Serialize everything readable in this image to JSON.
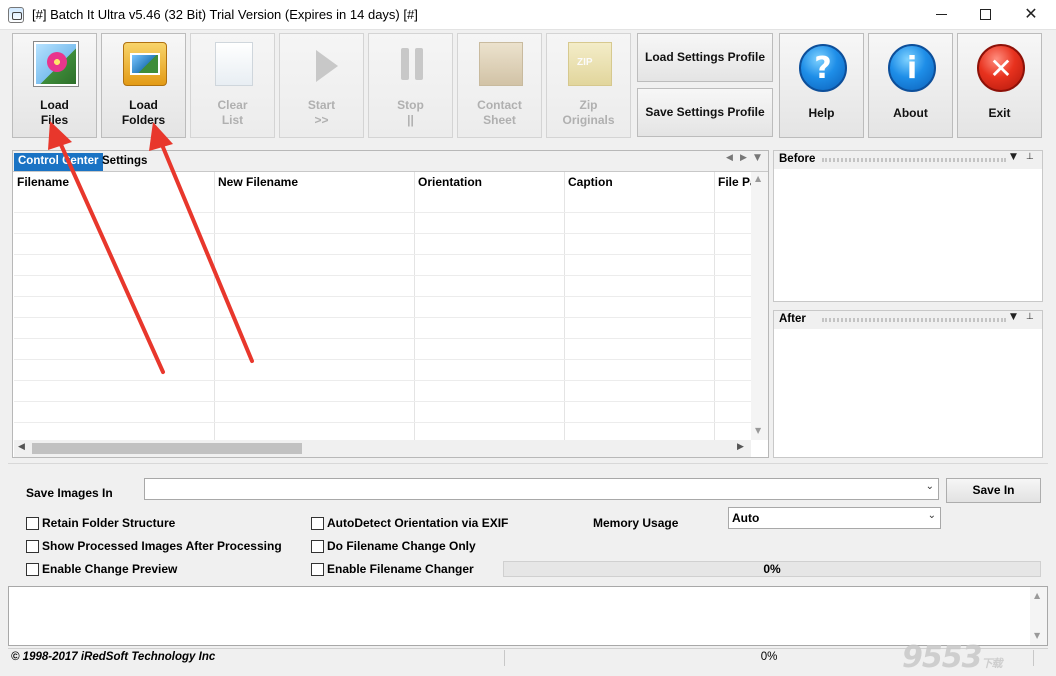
{
  "window": {
    "title": "[#] Batch It Ultra v5.46 (32 Bit) Trial Version (Expires in 14 days) [#]",
    "minimize_icon": "minimize-icon",
    "maximize_icon": "maximize-icon",
    "close_glyph": "✕"
  },
  "toolbar": {
    "load_files": {
      "line1": "Load",
      "line2": "Files",
      "icon": "photo-flower-icon"
    },
    "load_folders": {
      "line1": "Load",
      "line2": "Folders",
      "icon": "photo-folder-icon"
    },
    "clear_list": {
      "line1": "Clear",
      "line2": "List",
      "icon": "blank-page-icon"
    },
    "start": {
      "line1": "Start",
      "line2": ">>",
      "icon": "play-icon"
    },
    "stop": {
      "line1": "Stop",
      "line2": "||",
      "icon": "pause-icon"
    },
    "contact_sheet": {
      "line1": "Contact",
      "line2": "Sheet",
      "icon": "printer-icon"
    },
    "zip_originals": {
      "line1": "Zip",
      "line2": "Originals",
      "icon": "zip-archive-icon",
      "icon_text": "ZIP"
    },
    "load_settings_profile": "Load Settings Profile",
    "save_settings_profile": "Save Settings Profile",
    "help": {
      "label": "Help",
      "glyph": "?",
      "icon": "help-icon"
    },
    "about": {
      "label": "About",
      "glyph": "i",
      "icon": "info-icon"
    },
    "exit": {
      "label": "Exit",
      "glyph": "✕",
      "icon": "exit-icon"
    }
  },
  "tabs": {
    "control_center": "Control Center",
    "settings": "Settings",
    "nav_prev": "◀",
    "nav_next": "▶",
    "nav_menu": "▼"
  },
  "grid": {
    "columns": [
      "Filename",
      "New Filename",
      "Orientation",
      "Caption",
      "File Pa"
    ],
    "rows": []
  },
  "preview": {
    "before_title": "Before",
    "after_title": "After",
    "menu_glyph": "▼",
    "pin_glyph": "⊥"
  },
  "options": {
    "save_images_in_label": "Save Images In",
    "save_images_in_value": "",
    "save_in_button": "Save In",
    "memory_usage_label": "Memory Usage",
    "memory_usage_value": "Auto",
    "checkboxes": {
      "retain_folder_structure": {
        "label": "Retain Folder Structure",
        "checked": false
      },
      "show_processed": {
        "label": "Show Processed Images After Processing",
        "checked": false
      },
      "enable_change_preview": {
        "label": "Enable Change Preview",
        "checked": false
      },
      "autodetect_orientation": {
        "label": "AutoDetect Orientation via EXIF",
        "checked": false
      },
      "filename_change_only": {
        "label": "Do Filename Change Only",
        "checked": false
      },
      "enable_filename_changer": {
        "label": "Enable Filename Changer",
        "checked": false
      }
    },
    "progress_text": "0%",
    "progress_value": 0
  },
  "statusbar": {
    "copyright": "© 1998-2017 iRedSoft Technology Inc",
    "progress_text": "0%"
  },
  "watermark": {
    "text": "9553",
    "suffix": "下载"
  },
  "colors": {
    "tab_active": "#1a73c4",
    "annotation_arrow": "#e8372c"
  }
}
